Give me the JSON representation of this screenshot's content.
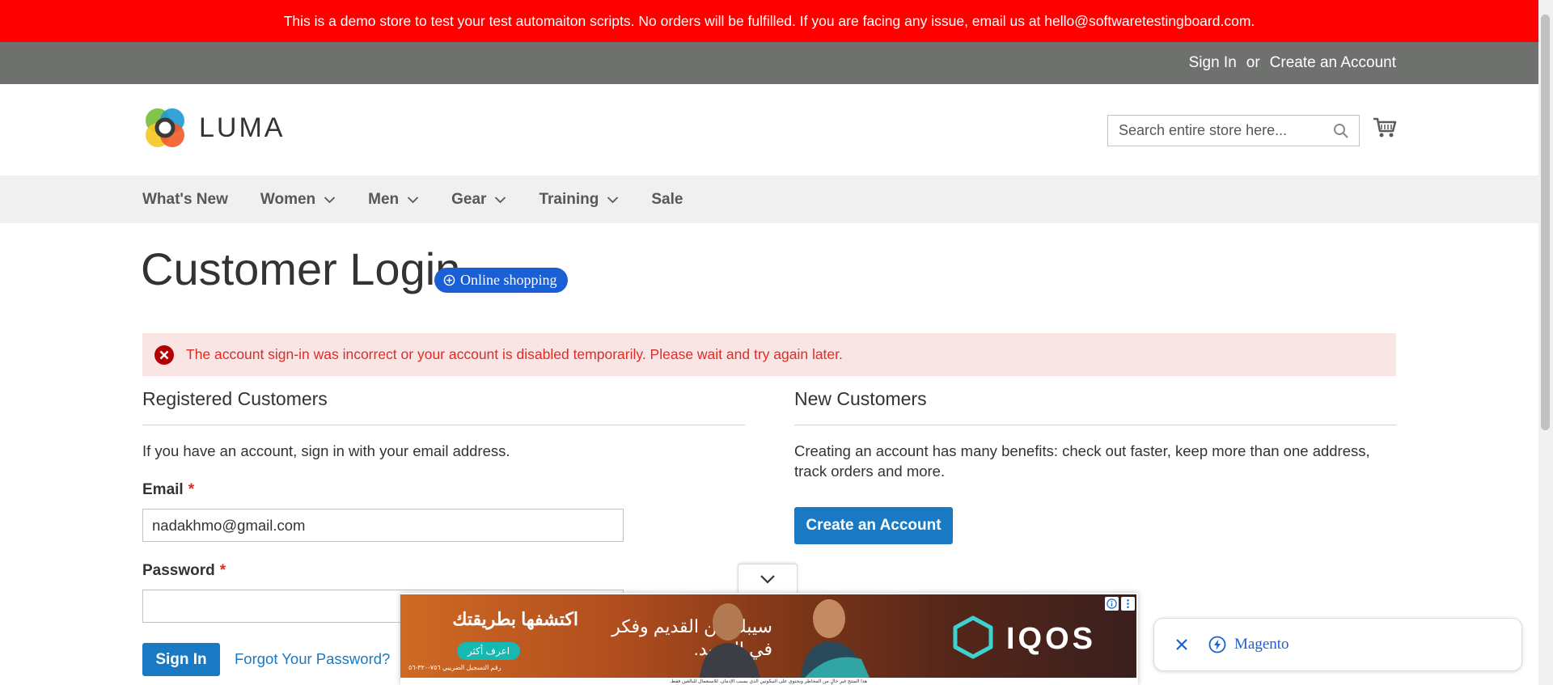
{
  "notice": "This is a demo store to test your test automaiton scripts. No orders will be fulfilled. If you are facing any issue, email us at hello@softwaretestingboard.com.",
  "header_links": {
    "sign_in": "Sign In",
    "or": "or",
    "create_account": "Create an Account"
  },
  "logo": {
    "text": "LUMA",
    "icon": "luma-logo-icon"
  },
  "search": {
    "placeholder": "Search entire store here...",
    "icon": "search-icon"
  },
  "cart": {
    "icon": "cart-icon"
  },
  "nav": [
    {
      "label": "What's New",
      "has_menu": false
    },
    {
      "label": "Women",
      "has_menu": true
    },
    {
      "label": "Men",
      "has_menu": true
    },
    {
      "label": "Gear",
      "has_menu": true
    },
    {
      "label": "Training",
      "has_menu": true
    },
    {
      "label": "Sale",
      "has_menu": false
    }
  ],
  "page_title": "Customer Login",
  "chip": {
    "label": "Online shopping",
    "icon": "plus-circle-icon"
  },
  "error": {
    "message": "The account sign-in was incorrect or your account is disabled temporarily. Please wait and try again later.",
    "icon": "error-icon"
  },
  "registered": {
    "heading": "Registered Customers",
    "intro": "If you have an account, sign in with your email address.",
    "email_label": "Email",
    "email_value": "nadakhmo@gmail.com",
    "password_label": "Password",
    "password_value": "",
    "required_mark": "*",
    "sign_in_button": "Sign In",
    "forgot_link": "Forgot Your Password?"
  },
  "new_customers": {
    "heading": "New Customers",
    "intro": "Creating an account has many benefits: check out faster, keep more than one address, track orders and more.",
    "create_button": "Create an Account"
  },
  "ad": {
    "headline": "اكتشفها بطريقتك",
    "button": "اعرف أكثر",
    "tagline": "سيبك من القديم وفكر في الجديد.",
    "brand": "IQOS",
    "small_text": "رقم التسجيل الضريبي ٧٥٦-٣٢٠-٥٦",
    "footer": "هذا المنتج غير خالٍ من المخاطر ويحتوي على النيكوتين الذي يسبب الإدمان. للاستعمال للبالغين فقط."
  },
  "magento_chip": {
    "label": "Magento",
    "close_icon": "close-icon",
    "icon": "bolt-icon"
  },
  "colors": {
    "notice": "#ff0000",
    "panel": "#6e716e",
    "accent": "#1979c3",
    "error_text": "#e02b27",
    "error_bg": "#fae5e5"
  }
}
